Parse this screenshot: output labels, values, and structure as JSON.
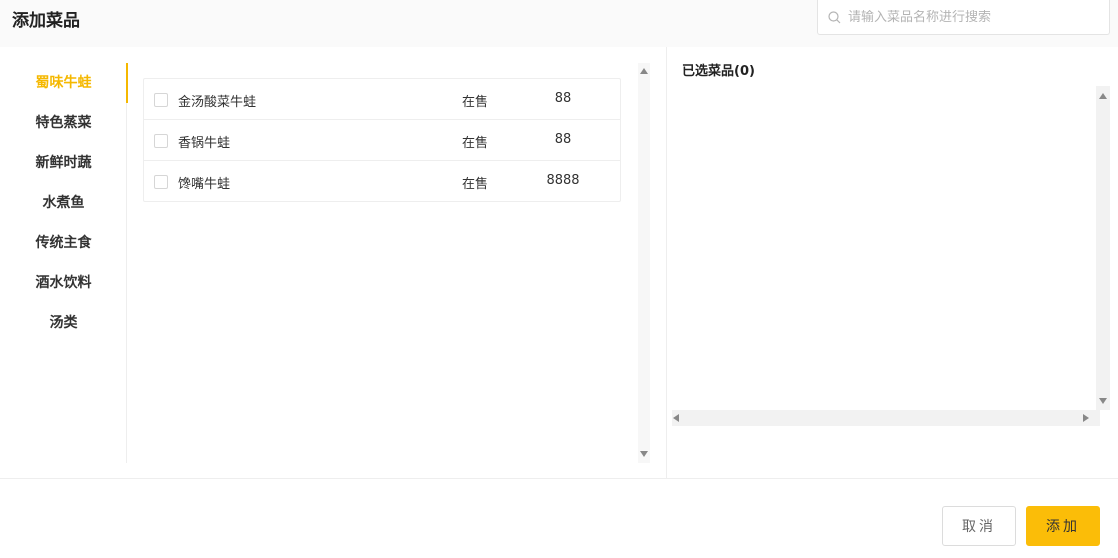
{
  "header": {
    "title": "添加菜品"
  },
  "search": {
    "placeholder": "请输入菜品名称进行搜索",
    "value": ""
  },
  "categories": [
    {
      "label": "蜀味牛蛙",
      "active": true
    },
    {
      "label": "特色蒸菜",
      "active": false
    },
    {
      "label": "新鲜时蔬",
      "active": false
    },
    {
      "label": "水煮鱼",
      "active": false
    },
    {
      "label": "传统主食",
      "active": false
    },
    {
      "label": "酒水饮料",
      "active": false
    },
    {
      "label": "汤类",
      "active": false
    }
  ],
  "dishes": [
    {
      "name": "金汤酸菜牛蛙",
      "status": "在售",
      "price": "88",
      "checked": false
    },
    {
      "name": "香锅牛蛙",
      "status": "在售",
      "price": "88",
      "checked": false
    },
    {
      "name": "馋嘴牛蛙",
      "status": "在售",
      "price": "8888",
      "checked": false
    }
  ],
  "selected": {
    "title": "已选菜品(0)"
  },
  "footer": {
    "cancel_label": "取消",
    "add_label": "添加"
  },
  "colors": {
    "accent": "#f5b800",
    "button": "#fbbd08"
  }
}
